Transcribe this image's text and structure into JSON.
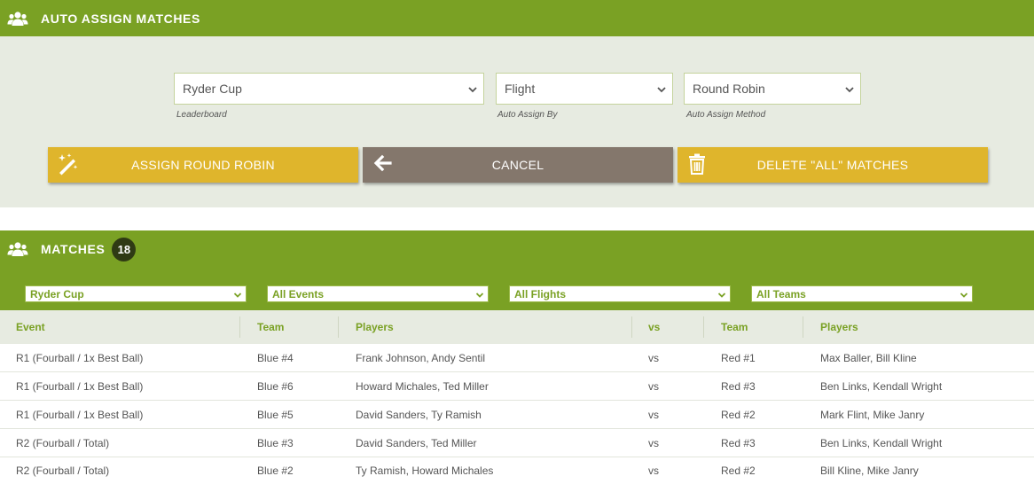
{
  "assign": {
    "title": "AUTO ASSIGN MATCHES",
    "leaderboard": {
      "value": "Ryder Cup",
      "label": "Leaderboard"
    },
    "assign_by": {
      "value": "Flight",
      "label": "Auto Assign By"
    },
    "method": {
      "value": "Round Robin",
      "label": "Auto Assign Method"
    },
    "buttons": {
      "assign": "ASSIGN ROUND ROBIN",
      "cancel": "CANCEL",
      "delete": "DELETE \"ALL\" MATCHES"
    }
  },
  "matches": {
    "title": "MATCHES",
    "count": "18",
    "filters": {
      "leaderboard": "Ryder Cup",
      "events": "All Events",
      "flights": "All Flights",
      "teams": "All Teams"
    },
    "columns": {
      "event": "Event",
      "team1": "Team",
      "players1": "Players",
      "vs": "vs",
      "team2": "Team",
      "players2": "Players"
    },
    "rows": [
      {
        "event": "R1 (Fourball / 1x Best Ball)",
        "team1": "Blue #4",
        "players1": "Frank Johnson, Andy Sentil",
        "vs": "vs",
        "team2": "Red #1",
        "players2": "Max Baller, Bill Kline"
      },
      {
        "event": "R1 (Fourball / 1x Best Ball)",
        "team1": "Blue #6",
        "players1": "Howard Michales, Ted Miller",
        "vs": "vs",
        "team2": "Red #3",
        "players2": "Ben Links, Kendall Wright"
      },
      {
        "event": "R1 (Fourball / 1x Best Ball)",
        "team1": "Blue #5",
        "players1": "David Sanders, Ty Ramish",
        "vs": "vs",
        "team2": "Red #2",
        "players2": "Mark Flint, Mike Janry"
      },
      {
        "event": "R2 (Fourball / Total)",
        "team1": "Blue #3",
        "players1": "David Sanders, Ted Miller",
        "vs": "vs",
        "team2": "Red #3",
        "players2": "Ben Links, Kendall Wright"
      },
      {
        "event": "R2 (Fourball / Total)",
        "team1": "Blue #2",
        "players1": "Ty Ramish, Howard Michales",
        "vs": "vs",
        "team2": "Red #2",
        "players2": "Bill Kline, Mike Janry"
      }
    ]
  },
  "colors": {
    "brand_green": "#7aa124",
    "panel_bg": "#e7ebe1",
    "button_yellow": "#dfb52c",
    "button_gray": "#84776c",
    "badge_dark": "#2f3a14"
  },
  "icons": {
    "header": "users-icon",
    "assign": "magic-wand-icon",
    "cancel": "arrow-left-icon",
    "delete": "trash-icon",
    "dropdown": "chevron-down-icon"
  }
}
